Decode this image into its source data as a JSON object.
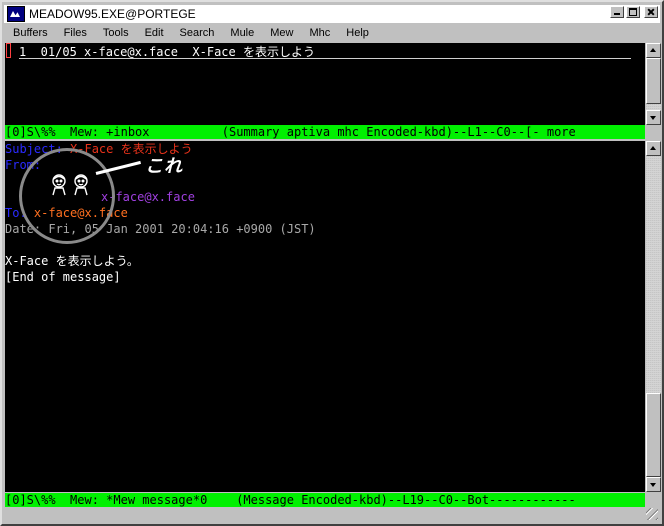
{
  "window": {
    "title": "MEADOW95.EXE@PORTEGE",
    "icon": "app-window-icon",
    "controls": [
      "minimize-icon",
      "maximize-icon",
      "close-icon"
    ]
  },
  "menu": [
    "Buffers",
    "Files",
    "Tools",
    "Edit",
    "Search",
    "Mule",
    "Mew",
    "Mhc",
    "Help"
  ],
  "summary": {
    "line": "1  01/05 x-face@x.face  X-Face を表示しよう",
    "modeline": "[0]S\\%%  Mew: +inbox          (Summary aptiva mhc Encoded-kbd)--L1--C0--[- more"
  },
  "message": {
    "subject_label": "Subject:",
    "subject_value": " X-Face を表示しよう",
    "from_label": "From:",
    "from_value": "x-face@x.face",
    "to_label": "To:",
    "to_value": " x-face@x.face",
    "date_line": "Date: Fri, 05 Jan 2001 20:04:16 +0900 (JST)",
    "body_1": "X-Face を表示しよう。",
    "body_2": "[End of message]",
    "modeline": "[0]S\\%%  Mew: *Mew message*0    (Message Encoded-kbd)--L19--C0--Bot------------"
  },
  "annotation": {
    "label": "これ"
  },
  "colors": {
    "modeline_bg": "#00f000",
    "header_label": "#2a2aff",
    "subject": "#e8321a",
    "from": "#a040e0",
    "to": "#ff7020",
    "date": "#a8a8a8"
  }
}
